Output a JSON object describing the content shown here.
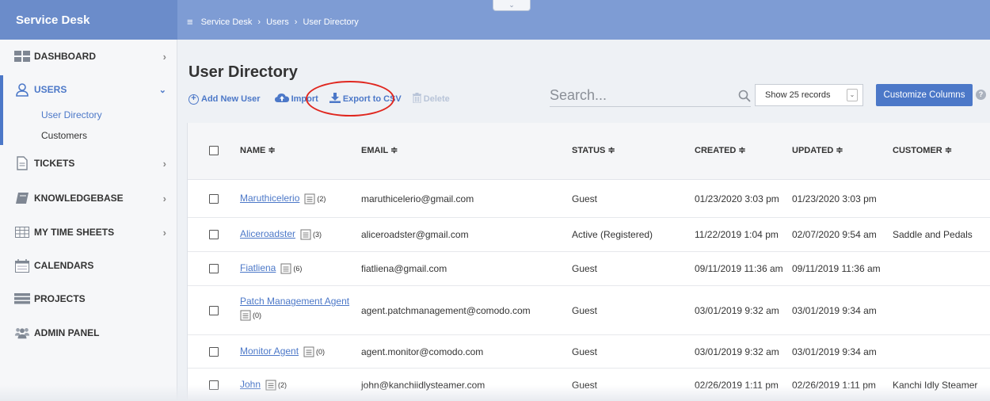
{
  "app": {
    "title": "Service Desk"
  },
  "header": {
    "collapse_glyph": "⌄",
    "menu_glyph": "≡",
    "breadcrumb": [
      "Service Desk",
      "Users",
      "User Directory"
    ]
  },
  "sidebar": {
    "items": [
      {
        "label": "DASHBOARD",
        "icon": "dashboard-icon"
      },
      {
        "label": "USERS",
        "icon": "user-icon",
        "active": true,
        "sub": [
          "User Directory",
          "Customers"
        ]
      },
      {
        "label": "TICKETS",
        "icon": "ticket-icon"
      },
      {
        "label": "KNOWLEDGEBASE",
        "icon": "book-icon"
      },
      {
        "label": "MY TIME SHEETS",
        "icon": "timesheet-icon"
      },
      {
        "label": "CALENDARS",
        "icon": "calendar-icon"
      },
      {
        "label": "PROJECTS",
        "icon": "projects-icon"
      },
      {
        "label": "ADMIN PANEL",
        "icon": "admin-icon"
      }
    ]
  },
  "main": {
    "title": "User Directory",
    "toolbar": {
      "add_label": "Add New User",
      "import_label": "Import",
      "export_label": "Export to CSV",
      "delete_label": "Delete"
    },
    "search": {
      "placeholder": "Search...",
      "value": ""
    },
    "records": {
      "selected": "Show 25 records"
    },
    "customize_label": "Customize Columns",
    "help_glyph": "?",
    "accent_color": "#4c78c8",
    "highlight_color": "#e0271f"
  },
  "table": {
    "sort_glyph": "≑",
    "columns": [
      "NAME",
      "EMAIL",
      "STATUS",
      "CREATED",
      "UPDATED",
      "CUSTOMER"
    ],
    "rows": [
      {
        "name": "Maruthicelerio",
        "count": "(2)",
        "email": "maruthicelerio@gmail.com",
        "status": "Guest",
        "created": "01/23/2020 3:03 pm",
        "updated": "01/23/2020 3:03 pm",
        "customer": ""
      },
      {
        "name": "Aliceroadster",
        "count": "(3)",
        "email": "aliceroadster@gmail.com",
        "status": "Active (Registered)",
        "created": "11/22/2019 1:04 pm",
        "updated": "02/07/2020 9:54 am",
        "customer": "Saddle and Pedals"
      },
      {
        "name": "Fiatliena",
        "count": "(6)",
        "email": "fiatliena@gmail.com",
        "status": "Guest",
        "created": "09/11/2019 11:36 am",
        "updated": "09/11/2019 11:36 am",
        "customer": ""
      },
      {
        "name": "Patch Management Agent",
        "count": "(0)",
        "email": "agent.patchmanagement@comodo.com",
        "status": "Guest",
        "created": "03/01/2019 9:32 am",
        "updated": "03/01/2019 9:34 am",
        "customer": ""
      },
      {
        "name": "Monitor Agent",
        "count": "(0)",
        "email": "agent.monitor@comodo.com",
        "status": "Guest",
        "created": "03/01/2019 9:32 am",
        "updated": "03/01/2019 9:34 am",
        "customer": ""
      },
      {
        "name": "John",
        "count": "(2)",
        "email": "john@kanchiidlysteamer.com",
        "status": "Guest",
        "created": "02/26/2019 1:11 pm",
        "updated": "02/26/2019 1:11 pm",
        "customer": "Kanchi Idly Steamer"
      }
    ]
  }
}
